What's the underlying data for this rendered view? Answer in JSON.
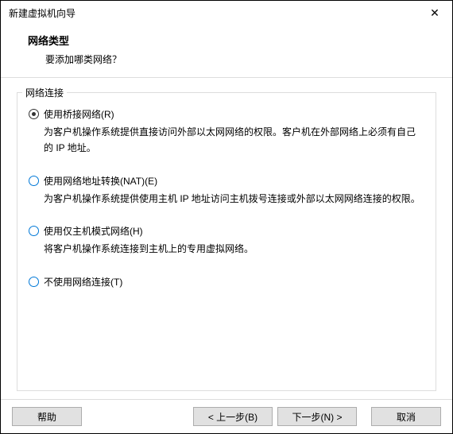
{
  "titlebar": {
    "title": "新建虚拟机向导",
    "close": "✕"
  },
  "header": {
    "title": "网络类型",
    "subtitle": "要添加哪类网络？"
  },
  "groupbox": {
    "legend": "网络连接"
  },
  "options": {
    "bridged": {
      "label": "使用桥接网络(R)",
      "desc": "为客户机操作系统提供直接访问外部以太网网络的权限。客户机在外部网络上必须有自己的 IP 地址。"
    },
    "nat": {
      "label": "使用网络地址转换(NAT)(E)",
      "desc": "为客户机操作系统提供使用主机 IP 地址访问主机拨号连接或外部以太网网络连接的权限。"
    },
    "hostonly": {
      "label": "使用仅主机模式网络(H)",
      "desc": "将客户机操作系统连接到主机上的专用虚拟网络。"
    },
    "none": {
      "label": "不使用网络连接(T)"
    }
  },
  "footer": {
    "help": "帮助",
    "back": "< 上一步(B)",
    "next": "下一步(N) >",
    "cancel": "取消"
  }
}
